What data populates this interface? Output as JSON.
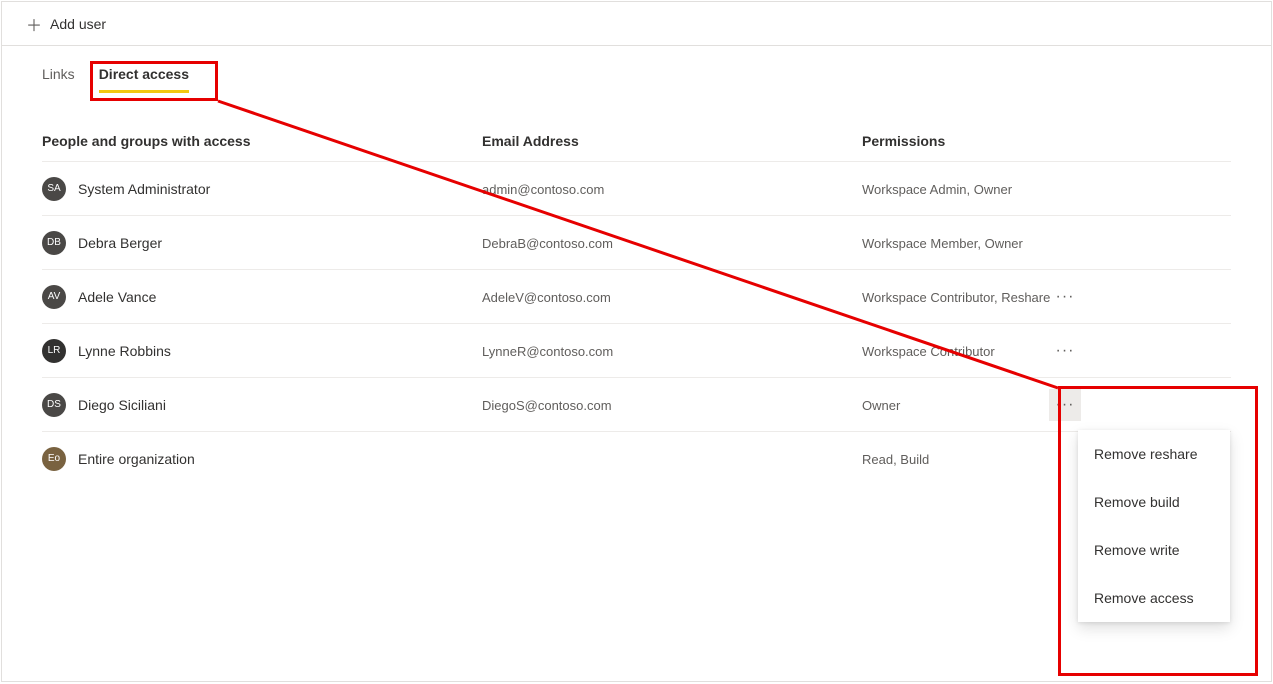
{
  "toolbar": {
    "add_user_label": "Add user"
  },
  "tabs": {
    "links_label": "Links",
    "direct_access_label": "Direct access"
  },
  "headers": {
    "people_label": "People and groups with access",
    "email_label": "Email Address",
    "permissions_label": "Permissions"
  },
  "users": [
    {
      "initials": "SA",
      "avatar_color": "#4a4846",
      "name": "System Administrator",
      "email": "admin@contoso.com",
      "permissions": "Workspace Admin, Owner",
      "has_more": false
    },
    {
      "initials": "DB",
      "avatar_color": "#4a4846",
      "name": "Debra Berger",
      "email": "DebraB@contoso.com",
      "permissions": "Workspace Member, Owner",
      "has_more": false
    },
    {
      "initials": "AV",
      "avatar_color": "#4a4846",
      "name": "Adele Vance",
      "email": "AdeleV@contoso.com",
      "permissions": "Workspace Contributor, Reshare",
      "has_more": true
    },
    {
      "initials": "LR",
      "avatar_color": "#323130",
      "name": "Lynne Robbins",
      "email": "LynneR@contoso.com",
      "permissions": "Workspace Contributor",
      "has_more": true
    },
    {
      "initials": "DS",
      "avatar_color": "#4a4846",
      "name": "Diego Siciliani",
      "email": "DiegoS@contoso.com",
      "permissions": "Owner",
      "has_more": true,
      "more_active": true
    },
    {
      "initials": "Eo",
      "avatar_color": "#796240",
      "name": "Entire organization",
      "email": "",
      "permissions": "Read, Build",
      "has_more": false
    }
  ],
  "context_menu": {
    "items": [
      "Remove reshare",
      "Remove build",
      "Remove write",
      "Remove access"
    ]
  }
}
